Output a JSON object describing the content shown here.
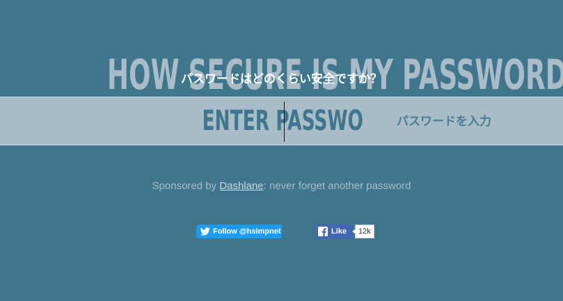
{
  "header": {
    "title": "HOW SECURE IS MY PASSWORD?",
    "subtitle": "パスワードはどのくらい安全ですか？"
  },
  "password": {
    "placeholder": "ENTER PASSWORD",
    "value": "",
    "hint": "パスワードを入力"
  },
  "sponsor": {
    "prefix": "Sponsored by ",
    "link": "Dashlane",
    "suffix": ": never forget another password"
  },
  "social": {
    "twitter_label": "Follow @hsimpnet",
    "facebook_label": "Like",
    "facebook_count": "12k"
  },
  "colors": {
    "background": "#3f768e",
    "band": "#a9bdc8",
    "title": "#a9bcc7",
    "twitter": "#1d9bf0",
    "facebook": "#4267b2"
  },
  "icons": {
    "twitter": "twitter-bird-icon",
    "facebook": "facebook-f-icon"
  }
}
